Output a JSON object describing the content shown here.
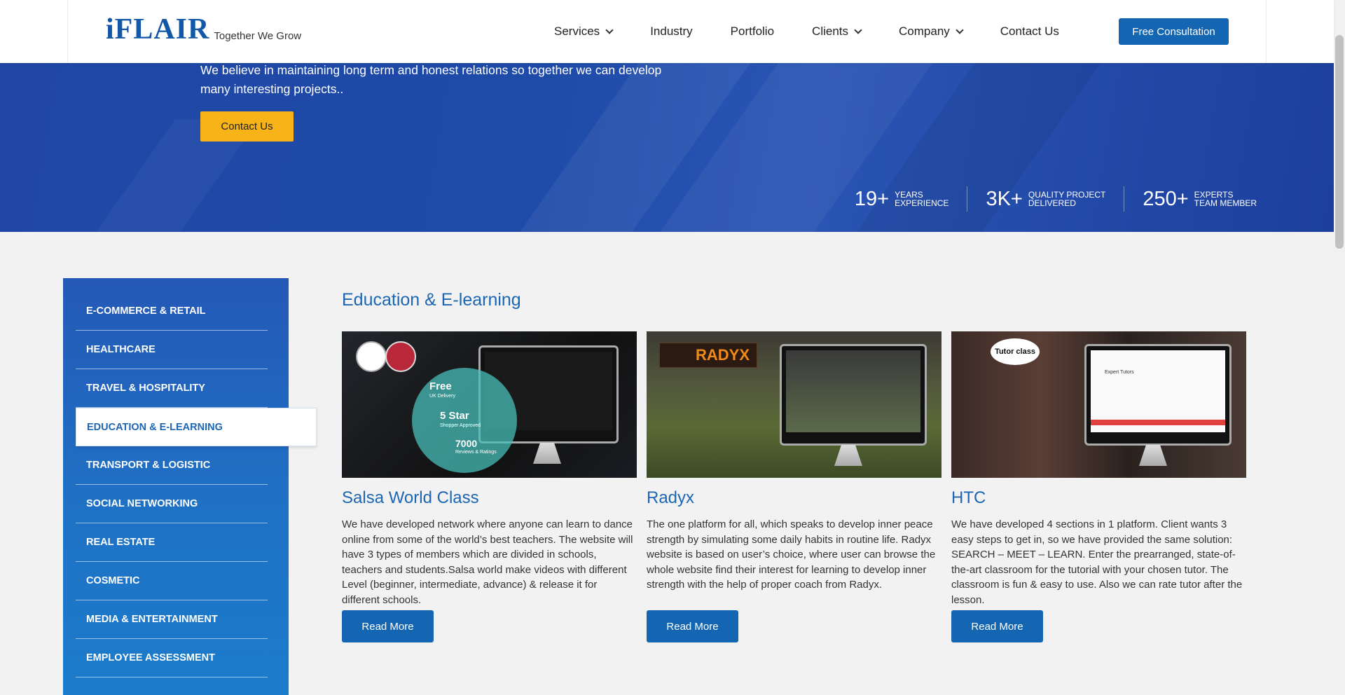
{
  "header": {
    "logo_text": "iFLAIR",
    "tagline": "Together We Grow",
    "nav": [
      {
        "label": "Services",
        "dropdown": true
      },
      {
        "label": "Industry",
        "dropdown": false
      },
      {
        "label": "Portfolio",
        "dropdown": false
      },
      {
        "label": "Clients",
        "dropdown": true
      },
      {
        "label": "Company",
        "dropdown": true
      },
      {
        "label": "Contact Us",
        "dropdown": false
      }
    ],
    "cta_label": "Free Consultation"
  },
  "hero": {
    "text": "We believe in maintaining long term and honest relations so together we can develop many interesting projects..",
    "button_label": "Contact Us",
    "stats": [
      {
        "number": "19+",
        "line1": "YEARS",
        "line2": "EXPERIENCE"
      },
      {
        "number": "3K+",
        "line1": "QUALITY PROJECT",
        "line2": "DELIVERED"
      },
      {
        "number": "250+",
        "line1": "EXPERTS",
        "line2": "TEAM MEMBER"
      }
    ]
  },
  "sidebar": {
    "items": [
      {
        "label": "E-COMMERCE & RETAIL",
        "active": false
      },
      {
        "label": "HEALTHCARE",
        "active": false
      },
      {
        "label": "TRAVEL & HOSPITALITY",
        "active": false
      },
      {
        "label": "EDUCATION & E-LEARNING",
        "active": true
      },
      {
        "label": "TRANSPORT & LOGISTIC",
        "active": false
      },
      {
        "label": "SOCIAL NETWORKING",
        "active": false
      },
      {
        "label": "REAL ESTATE",
        "active": false
      },
      {
        "label": "COSMETIC",
        "active": false
      },
      {
        "label": "MEDIA & ENTERTAINMENT",
        "active": false
      },
      {
        "label": "EMPLOYEE ASSESSMENT",
        "active": false
      }
    ]
  },
  "main": {
    "title": "Education & E-learning",
    "cards": [
      {
        "title": "Salsa World Class",
        "description": "We have developed network where anyone can learn to dance online from some of the world’s best teachers. The website will have 3 types of members which are divided in schools, teachers and students.Salsa world make videos with different Level (beginner, intermediate, advance) & release it for different schools.",
        "button": "Read More",
        "image_text": {
          "l1": "Free",
          "l2": "UK Delivery",
          "l3": "5 Star",
          "l4": "Shopper Approved",
          "l5": "7000",
          "l6": "Reviews & Ratings"
        }
      },
      {
        "title": "Radyx",
        "description": "The one platform for all, which speaks to develop inner peace strength by simulating some daily habits in routine life. Radyx website is based on user’s choice, where user can browse the whole website find their interest for learning to develop inner strength with the help of proper coach from Radyx.",
        "button": "Read More",
        "image_text": {
          "logo": "RADYX"
        }
      },
      {
        "title": "HTC",
        "description": "We have developed 4 sections in 1 platform. Client wants 3 easy steps to get in, so we have provided the same solution: SEARCH – MEET – LEARN. Enter the prearranged, state-of-the-art classroom for the tutorial with your chosen tutor. The classroom is fun & easy to use. Also we can rate tutor after the lesson.",
        "button": "Read More",
        "image_text": {
          "logo": "Tutor class",
          "screen": "Expert Tutors"
        }
      }
    ]
  },
  "colors": {
    "brand_blue": "#1466b3",
    "hero_blue": "#2047a6",
    "accent_yellow": "#f7b318"
  }
}
